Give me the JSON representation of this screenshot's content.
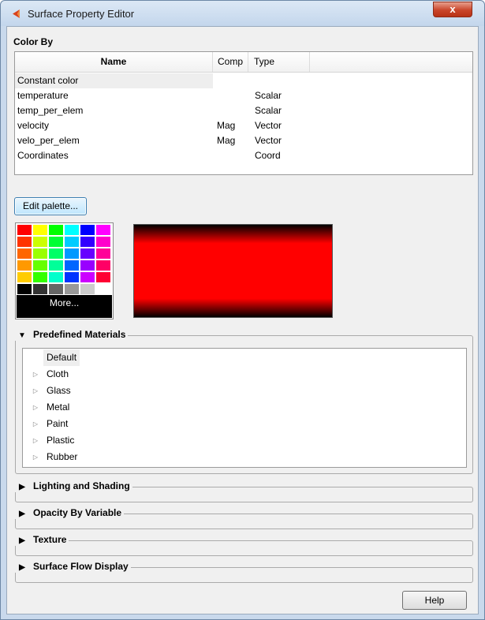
{
  "window": {
    "title": "Surface Property Editor",
    "close_label": "x"
  },
  "color_by": {
    "label": "Color By",
    "columns": [
      "Name",
      "Comp",
      "Type"
    ],
    "rows": [
      {
        "name": "Constant color",
        "comp": "",
        "type": ""
      },
      {
        "name": "temperature",
        "comp": "",
        "type": "Scalar"
      },
      {
        "name": "temp_per_elem",
        "comp": "",
        "type": "Scalar"
      },
      {
        "name": "velocity",
        "comp": "Mag",
        "type": "Vector"
      },
      {
        "name": "velo_per_elem",
        "comp": "Mag",
        "type": "Vector"
      },
      {
        "name": "Coordinates",
        "comp": "",
        "type": "Coord"
      }
    ]
  },
  "edit_palette_label": "Edit palette...",
  "palette": {
    "swatches": [
      [
        "#ff0000",
        "#ffff00",
        "#00ff00",
        "#00ffff",
        "#0000ff",
        "#ff00ff"
      ],
      [
        "#ff3300",
        "#ccff00",
        "#00ff33",
        "#00ccff",
        "#3300ff",
        "#ff00cc"
      ],
      [
        "#ff6600",
        "#99ff00",
        "#00ff66",
        "#0099ff",
        "#6600ff",
        "#ff0099"
      ],
      [
        "#ff9900",
        "#66ff00",
        "#00ff99",
        "#0066ff",
        "#9900ff",
        "#ff0066"
      ],
      [
        "#ffcc00",
        "#33ff00",
        "#00ffcc",
        "#0033ff",
        "#cc00ff",
        "#ff0033"
      ],
      [
        "#000000",
        "#333333",
        "#666666",
        "#999999",
        "#cccccc",
        "#ffffff"
      ]
    ],
    "more_label": "More..."
  },
  "preview_color": "#ff0000",
  "predefined_materials": {
    "label": "Predefined Materials",
    "items": [
      {
        "label": "Default",
        "expandable": false
      },
      {
        "label": "Cloth",
        "expandable": true
      },
      {
        "label": "Glass",
        "expandable": true
      },
      {
        "label": "Metal",
        "expandable": true
      },
      {
        "label": "Paint",
        "expandable": true
      },
      {
        "label": "Plastic",
        "expandable": true
      },
      {
        "label": "Rubber",
        "expandable": true
      }
    ]
  },
  "sections": {
    "lighting": "Lighting and Shading",
    "opacity": "Opacity By Variable",
    "texture": "Texture",
    "surface_flow": "Surface Flow Display"
  },
  "help_label": "Help"
}
